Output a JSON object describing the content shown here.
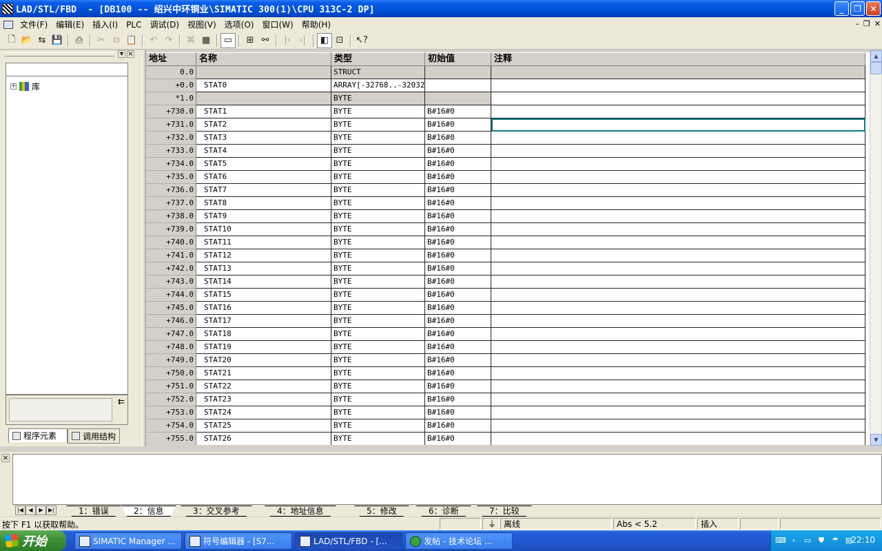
{
  "window": {
    "title": "LAD/STL/FBD  - [DB100 -- 绍兴中环铜业\\SIMATIC 300(1)\\CPU 313C-2 DP]",
    "min": "_",
    "max": "❐",
    "close": "✕"
  },
  "menu": [
    "文件(F)",
    "编辑(E)",
    "插入(I)",
    "PLC",
    "调试(D)",
    "视图(V)",
    "选项(O)",
    "窗口(W)",
    "帮助(H)"
  ],
  "mdi": {
    "min": "–",
    "restore": "❐",
    "close": "✕"
  },
  "leftpanel": {
    "tree_root": "库",
    "tabs": [
      "程序元素",
      "调用结构"
    ],
    "arrow_icon": "⇇"
  },
  "grid": {
    "headers": {
      "addr": "地址",
      "name": "名称",
      "type": "类型",
      "init": "初始值",
      "comment": "注释"
    },
    "rows": [
      {
        "addr": "0.0",
        "name": "",
        "type": "STRUCT",
        "init": "",
        "style": "gray"
      },
      {
        "addr": "+0.0",
        "name": "STAT0",
        "type": "ARRAY[-32768..-32032]",
        "init": "",
        "style": ""
      },
      {
        "addr": "*1.0",
        "name": "",
        "type": "BYTE",
        "init": "",
        "style": "partgray"
      },
      {
        "addr": "+730.0",
        "name": "STAT1",
        "type": "BYTE",
        "init": "B#16#0",
        "style": ""
      },
      {
        "addr": "+731.0",
        "name": "STAT2",
        "type": "BYTE",
        "init": "B#16#0",
        "style": "",
        "selected": true
      },
      {
        "addr": "+732.0",
        "name": "STAT3",
        "type": "BYTE",
        "init": "B#16#0",
        "style": ""
      },
      {
        "addr": "+733.0",
        "name": "STAT4",
        "type": "BYTE",
        "init": "B#16#0",
        "style": ""
      },
      {
        "addr": "+734.0",
        "name": "STAT5",
        "type": "BYTE",
        "init": "B#16#0",
        "style": ""
      },
      {
        "addr": "+735.0",
        "name": "STAT6",
        "type": "BYTE",
        "init": "B#16#0",
        "style": ""
      },
      {
        "addr": "+736.0",
        "name": "STAT7",
        "type": "BYTE",
        "init": "B#16#0",
        "style": ""
      },
      {
        "addr": "+737.0",
        "name": "STAT8",
        "type": "BYTE",
        "init": "B#16#0",
        "style": ""
      },
      {
        "addr": "+738.0",
        "name": "STAT9",
        "type": "BYTE",
        "init": "B#16#0",
        "style": ""
      },
      {
        "addr": "+739.0",
        "name": "STAT10",
        "type": "BYTE",
        "init": "B#16#0",
        "style": ""
      },
      {
        "addr": "+740.0",
        "name": "STAT11",
        "type": "BYTE",
        "init": "B#16#0",
        "style": ""
      },
      {
        "addr": "+741.0",
        "name": "STAT12",
        "type": "BYTE",
        "init": "B#16#0",
        "style": ""
      },
      {
        "addr": "+742.0",
        "name": "STAT13",
        "type": "BYTE",
        "init": "B#16#0",
        "style": ""
      },
      {
        "addr": "+743.0",
        "name": "STAT14",
        "type": "BYTE",
        "init": "B#16#0",
        "style": ""
      },
      {
        "addr": "+744.0",
        "name": "STAT15",
        "type": "BYTE",
        "init": "B#16#0",
        "style": ""
      },
      {
        "addr": "+745.0",
        "name": "STAT16",
        "type": "BYTE",
        "init": "B#16#0",
        "style": ""
      },
      {
        "addr": "+746.0",
        "name": "STAT17",
        "type": "BYTE",
        "init": "B#16#0",
        "style": ""
      },
      {
        "addr": "+747.0",
        "name": "STAT18",
        "type": "BYTE",
        "init": "B#16#0",
        "style": ""
      },
      {
        "addr": "+748.0",
        "name": "STAT19",
        "type": "BYTE",
        "init": "B#16#0",
        "style": ""
      },
      {
        "addr": "+749.0",
        "name": "STAT20",
        "type": "BYTE",
        "init": "B#16#0",
        "style": ""
      },
      {
        "addr": "+750.0",
        "name": "STAT21",
        "type": "BYTE",
        "init": "B#16#0",
        "style": ""
      },
      {
        "addr": "+751.0",
        "name": "STAT22",
        "type": "BYTE",
        "init": "B#16#0",
        "style": ""
      },
      {
        "addr": "+752.0",
        "name": "STAT23",
        "type": "BYTE",
        "init": "B#16#0",
        "style": ""
      },
      {
        "addr": "+753.0",
        "name": "STAT24",
        "type": "BYTE",
        "init": "B#16#0",
        "style": ""
      },
      {
        "addr": "+754.0",
        "name": "STAT25",
        "type": "BYTE",
        "init": "B#16#0",
        "style": ""
      },
      {
        "addr": "+755.0",
        "name": "STAT26",
        "type": "BYTE",
        "init": "B#16#0",
        "style": ""
      }
    ]
  },
  "output": {
    "tabs": [
      "1：错误",
      "2：信息",
      "3：交叉参考",
      "4：地址信息",
      "5：修改",
      "6：诊断",
      "7：比较"
    ],
    "active_tab": 1
  },
  "status": {
    "help": "按下 F1 以获取帮助。",
    "conn": "离线",
    "pos": "Abs < 5.2",
    "mode": "插入"
  },
  "taskbar": {
    "start": "开始",
    "tasks": [
      "SIMATIC Manager ...",
      "符号编辑器 - [S7...",
      "LAD/STL/FBD  - [...",
      "发帖 - 技术论坛 ..."
    ],
    "active_task": 2,
    "clock": "22:10"
  }
}
